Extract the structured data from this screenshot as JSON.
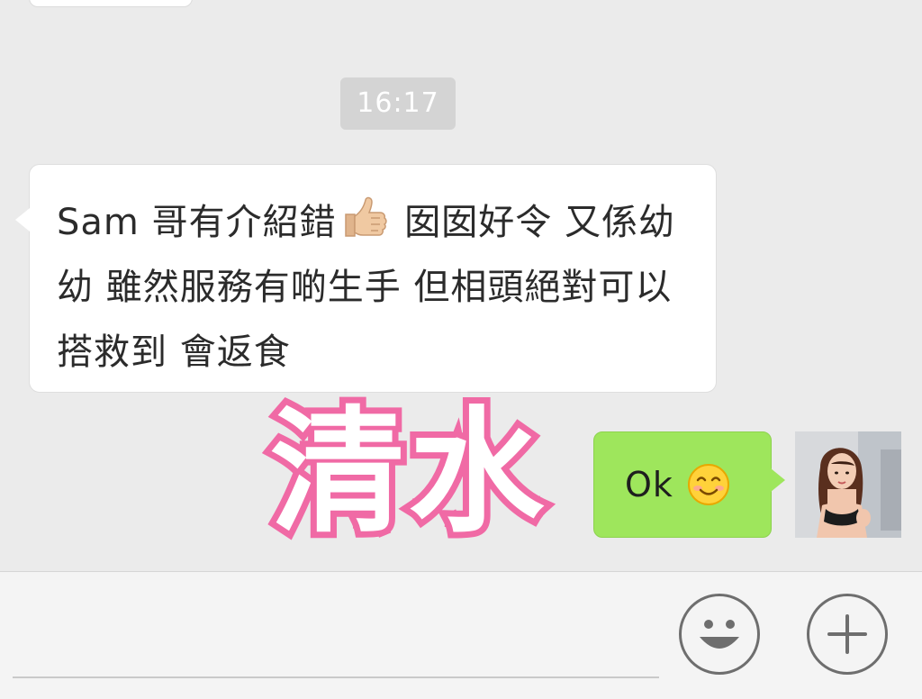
{
  "chat": {
    "timestamp": "16:17",
    "messages": [
      {
        "direction": "incoming",
        "text_before_emoji": "Sam 哥有介紹錯",
        "emoji": "thumbs-up-icon",
        "text_after_emoji": " 囡囡好令 又係幼幼 雖然服務有啲生手 但相頭絕對可以搭救到 會返食"
      },
      {
        "direction": "outgoing",
        "text": "Ok",
        "emoji": "smiling-face-icon"
      }
    ]
  },
  "watermark": {
    "text": "清水"
  },
  "colors": {
    "background": "#ebebeb",
    "incoming_bubble": "#ffffff",
    "outgoing_bubble": "#9ee65c",
    "timestamp_bg": "#d4d4d4",
    "watermark_stroke": "#f06aa5"
  },
  "input_bar": {
    "value": "",
    "emoji_button_icon": "emoji-icon",
    "more_button_icon": "plus-icon"
  }
}
